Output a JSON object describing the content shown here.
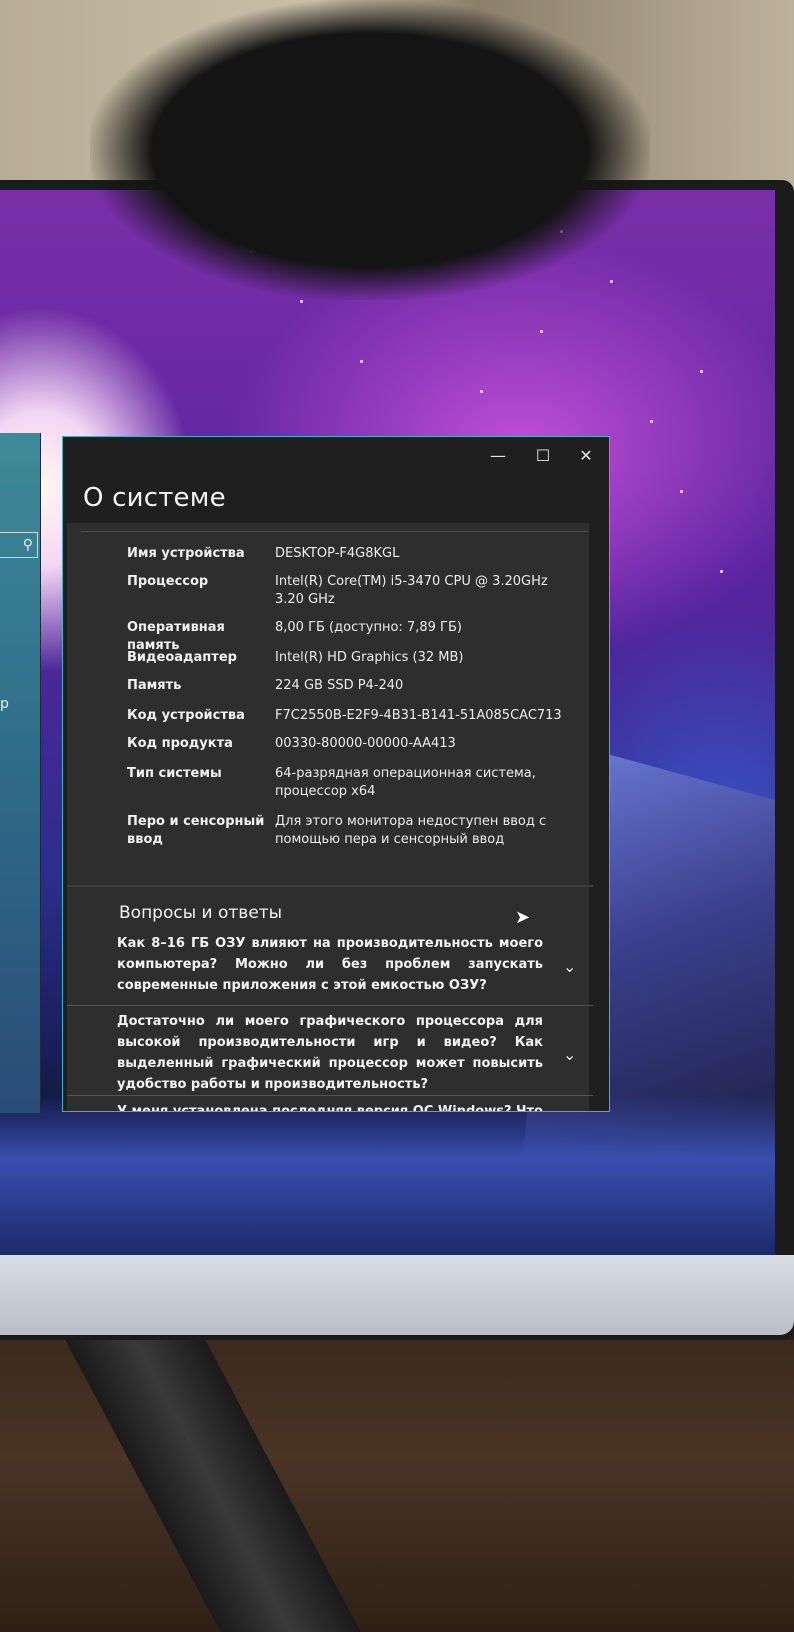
{
  "window": {
    "title": "О системе",
    "controls": {
      "minimize": "—",
      "maximize": "☐",
      "close": "✕"
    }
  },
  "specs": [
    {
      "label": "Имя устройства",
      "value": "DESKTOP-F4G8KGL"
    },
    {
      "label": "Процессор",
      "value": "Intel(R) Core(TM) i5-3470 CPU @ 3.20GHz 3.20 GHz"
    },
    {
      "label": "Оперативная память",
      "value": "8,00 ГБ (доступно: 7,89 ГБ)"
    },
    {
      "label": "Видеоадаптер",
      "value": "Intel(R) HD Graphics (32 MB)"
    },
    {
      "label": "Память",
      "value": "224 GB SSD P4-240"
    },
    {
      "label": "Код устройства",
      "value": "F7C2550B-E2F9-4B31-B141-51A085CAC713"
    },
    {
      "label": "Код продукта",
      "value": "00330-80000-00000-AA413"
    },
    {
      "label": "Тип системы",
      "value": "64-разрядная операционная система, процессор x64"
    },
    {
      "label": "Перо и сенсорный ввод",
      "value": "Для этого монитора недоступен ввод с помощью пера и сенсорный ввод"
    }
  ],
  "qa": {
    "title": "Вопросы и ответы",
    "items": [
      {
        "question": "Как 8–16 ГБ ОЗУ влияют на производительность моего компьютера? Можно ли без проблем запускать современные приложения с этой емкостью ОЗУ?"
      },
      {
        "question": "Достаточно ли моего графического процессора для высокой производительности игр и видео? Как выделенный графический процессор может повысить удобство работы и производительность?"
      },
      {
        "question": "У меня установлена последняя версия ОС Windows? Что"
      }
    ]
  },
  "background_settings": {
    "search_icon": "search-icon"
  },
  "icons": {
    "chevron": "chevron-down-icon",
    "cursor": "mouse-cursor-icon"
  },
  "colors": {
    "window_border": "#3fb0c8",
    "content_bg": "#2e2e2e",
    "window_bg": "#1f1f1f"
  }
}
